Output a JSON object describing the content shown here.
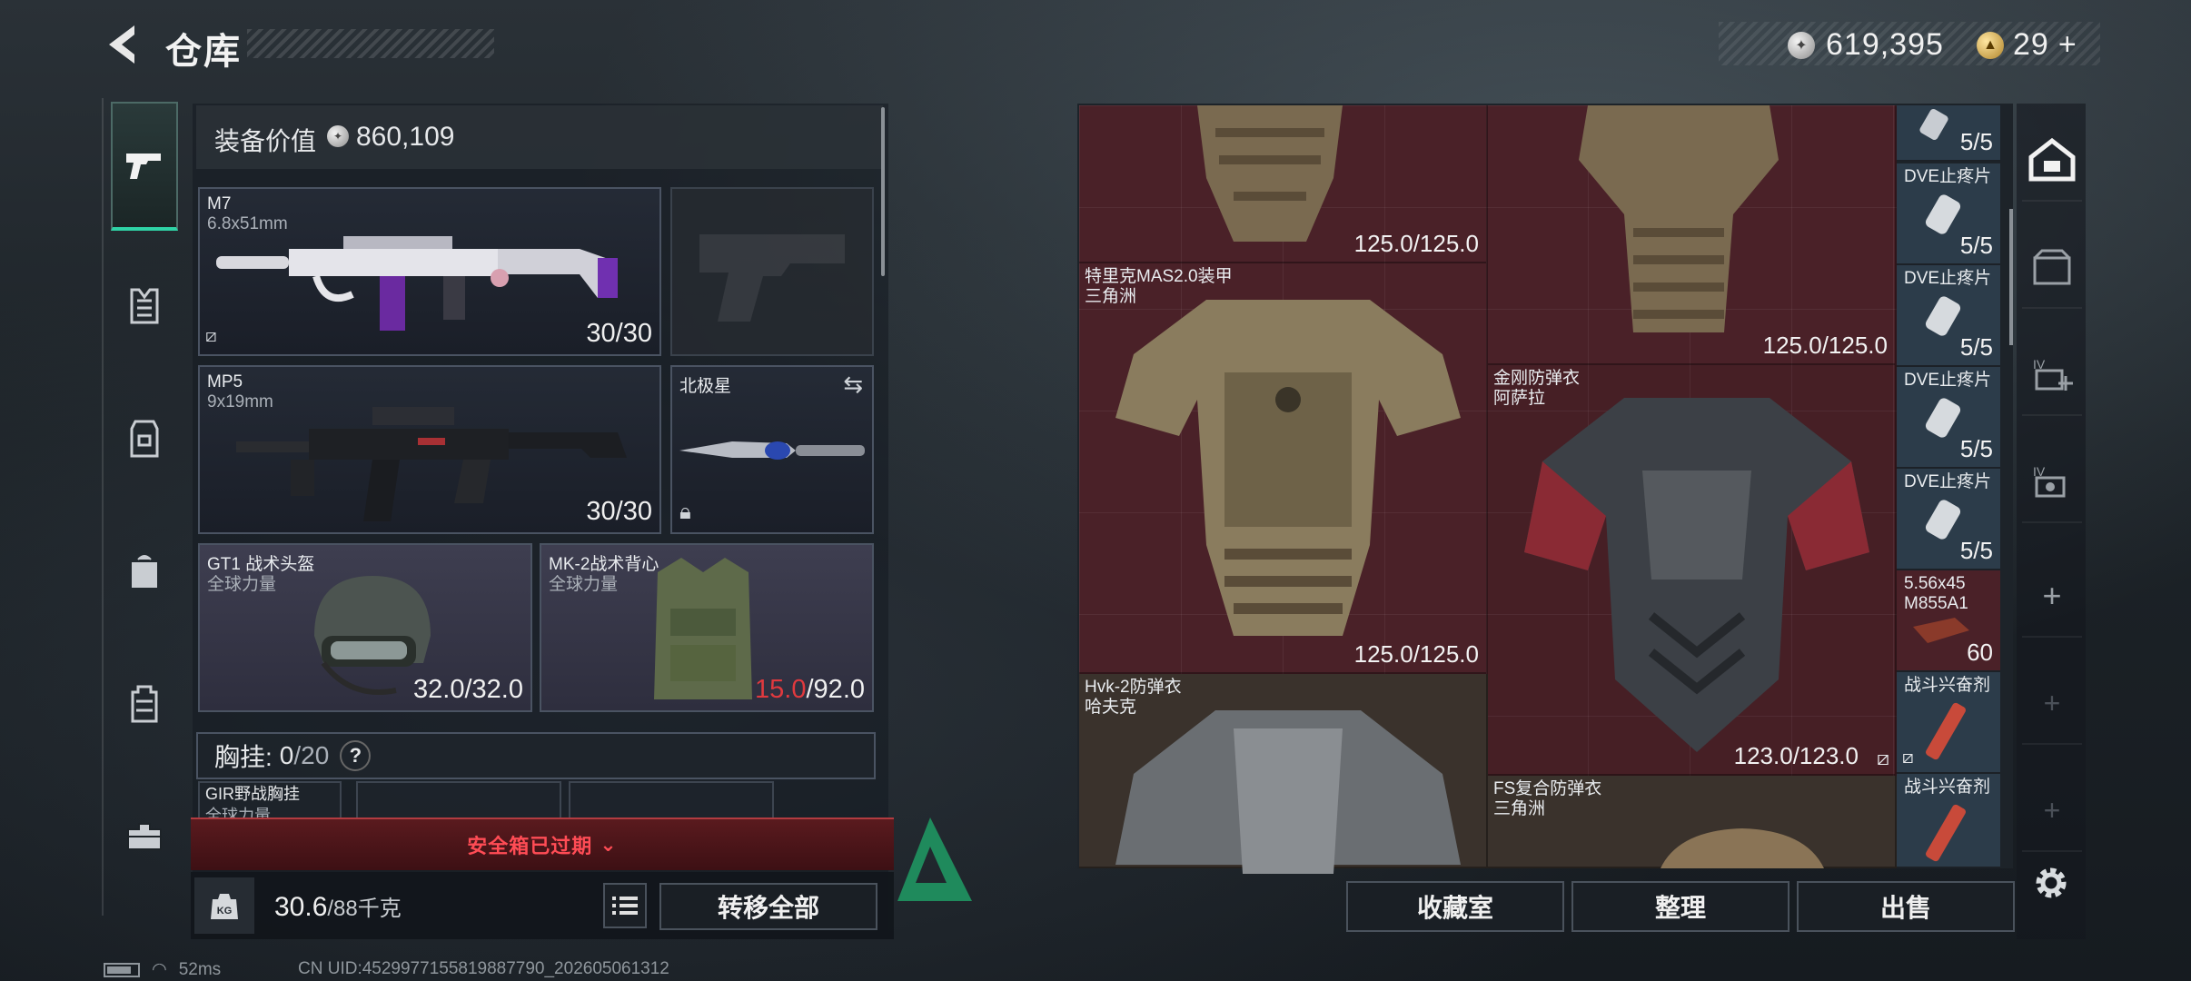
{
  "header": {
    "title": "仓库",
    "silver_amount": "619,395",
    "gold_amount": "29",
    "add_label": "+"
  },
  "equipment": {
    "value_label": "装备价值",
    "value": "860,109",
    "primary": {
      "name": "M7",
      "caliber": "6.8x51mm",
      "ammo": "30/30"
    },
    "secondary": {
      "name": "MP5",
      "caliber": "9x19mm",
      "ammo": "30/30"
    },
    "melee": {
      "name": "北极星"
    },
    "helmet": {
      "name": "GT1 战术头盔",
      "maker": "全球力量",
      "durability": "32.0/32.0"
    },
    "armor": {
      "name": "MK-2战术背心",
      "maker": "全球力量",
      "durability_current": "15.0",
      "durability_max": "/92.0"
    },
    "vest": {
      "label": "胸挂:",
      "current": "0",
      "max": "/20",
      "help": "?"
    },
    "lower_item": {
      "name": "GIR野战胸挂",
      "maker": "全球力量"
    }
  },
  "safebox": {
    "text": "安全箱已过期"
  },
  "weight": {
    "current": "30.6",
    "max": "/88千克",
    "icon_label": "KG"
  },
  "transfer_all_label": "转移全部",
  "warehouse": {
    "cells": [
      {
        "name": "",
        "maker": "",
        "durability": "125.0/125.0"
      },
      {
        "name": "",
        "maker": "",
        "durability": "125.0/125.0"
      },
      {
        "name": "特里克MAS2.0装甲",
        "maker": "三角洲",
        "durability": "125.0/125.0"
      },
      {
        "name": "金刚防弹衣",
        "maker": "阿萨拉",
        "durability": "123.0/123.0"
      },
      {
        "name": "Hvk-2防弹衣",
        "maker": "哈夫克",
        "durability": ""
      },
      {
        "name": "FS复合防弹衣",
        "maker": "三角洲",
        "durability": ""
      }
    ],
    "side_items": [
      {
        "name": "",
        "count": "5/5"
      },
      {
        "name": "DVE止疼片",
        "count": "5/5"
      },
      {
        "name": "DVE止疼片",
        "count": "5/5"
      },
      {
        "name": "DVE止疼片",
        "count": "5/5"
      },
      {
        "name": "DVE止疼片",
        "count": "5/5"
      },
      {
        "name": "5.56x45 M855A1",
        "count": "60"
      },
      {
        "name": "战斗兴奋剂",
        "count": ""
      },
      {
        "name": "战斗兴奋剂",
        "count": ""
      }
    ]
  },
  "actions": {
    "collection": "收藏室",
    "sort": "整理",
    "sell": "出售"
  },
  "status": {
    "ping": "52ms",
    "uid": "CN UID:4529977155819887790_202605061312"
  },
  "colors": {
    "accent": "#2fd3a6",
    "warning": "#e0393e",
    "warehouse_bg": "#4a2128"
  }
}
